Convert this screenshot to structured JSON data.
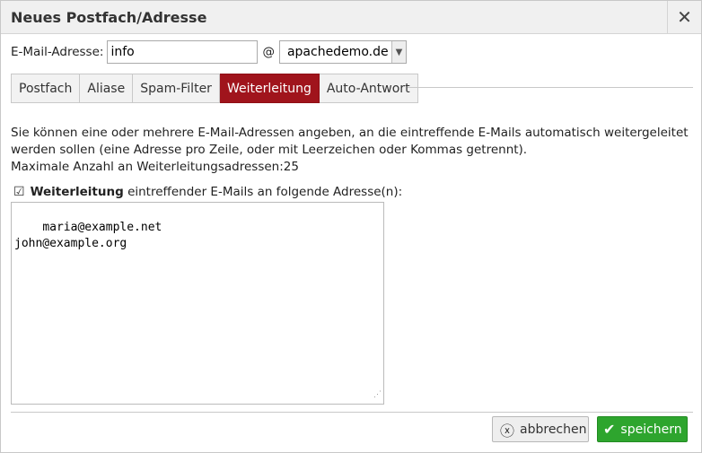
{
  "dialog": {
    "title": "Neues Postfach/Adresse",
    "close_icon": "close-icon",
    "close_glyph": "✕"
  },
  "address": {
    "label": "E-Mail-Adresse:",
    "local_part": "info",
    "at": "@",
    "domain": "apachedemo.de"
  },
  "tabs": [
    {
      "label": "Postfach",
      "active": false
    },
    {
      "label": "Aliase",
      "active": false
    },
    {
      "label": "Spam-Filter",
      "active": false
    },
    {
      "label": "Weiterleitung",
      "active": true
    },
    {
      "label": "Auto-Antwort",
      "active": false
    }
  ],
  "forwarding": {
    "description": "Sie können eine oder mehrere E-Mail-Adressen angeben, an die eintreffende E-Mails automatisch weitergeleitet werden sollen (eine Adresse pro Zeile, oder mit Leerzeichen oder Kommas getrennt).",
    "max_label": "Maximale Anzahl an Weiterleitungsadressen:25",
    "checkbox_checked": true,
    "checkbox_bold": "Weiterleitung",
    "checkbox_rest": " eintreffender E-Mails an folgende Adresse(n):",
    "addresses": "maria@example.net\njohn@example.org"
  },
  "buttons": {
    "cancel": "abbrechen",
    "save": "speichern"
  },
  "colors": {
    "active_tab": "#a0141c",
    "save_button": "#2ea52e"
  }
}
